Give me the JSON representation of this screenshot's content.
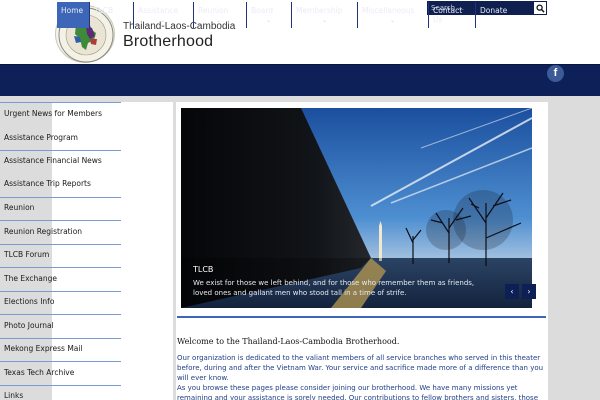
{
  "header": {
    "brand_line1": "Thailand-Laos-Cambodia",
    "brand_line2": "Brotherhood",
    "search_placeholder": "Search ..."
  },
  "nav": {
    "items": [
      {
        "label": "Home",
        "active": true,
        "has_submenu": false
      },
      {
        "label": "TLCB",
        "active": false,
        "has_submenu": true
      },
      {
        "label": "Assistance",
        "active": false,
        "has_submenu": true
      },
      {
        "label": "Reunion",
        "active": false,
        "has_submenu": true
      },
      {
        "label": "Board",
        "active": false,
        "has_submenu": true
      },
      {
        "label": "Membership",
        "active": false,
        "has_submenu": true
      },
      {
        "label": "Miscellaneous",
        "active": false,
        "has_submenu": true
      },
      {
        "label": "Contact Us",
        "active": false,
        "has_submenu": false
      },
      {
        "label": "Donate",
        "active": false,
        "has_submenu": false
      }
    ],
    "submenu_glyph": "⌄",
    "facebook_glyph": "f"
  },
  "sidebar": {
    "items": [
      "Urgent News for Members",
      "Assistance Program",
      "Assistance Financial News",
      "Assistance Trip Reports",
      "Reunion",
      "Reunion Registration",
      "TLCB Forum",
      "The Exchange",
      "Elections Info",
      "Photo Journal",
      "Mekong Express Mail",
      "Texas Tech Archive",
      "Links"
    ]
  },
  "slider": {
    "title": "TLCB",
    "text": "We exist for those we left behind, and for those who remember them as friends, loved ones and gallant men who stood tall in a time of strife.",
    "prev_glyph": "‹",
    "next_glyph": "›"
  },
  "main": {
    "welcome_title": "Welcome to the Thailand-Laos-Cambodia Brotherhood.",
    "para1": "Our organization is dedicated to the valiant members of all service branches who served in this theater before, during and after the Vietnam War. Your service and sacrifice made more of a difference than you will ever know.",
    "para2": "As you browse these pages please consider joining our brotherhood. We have many missions yet remaining and your assistance is sorely needed. Our contributions to fellow brothers and sisters, those we left behind in the"
  },
  "colors": {
    "nav_bg": "#0d2058",
    "nav_active": "#3e66b8",
    "accent_rule": "#3e66b8",
    "link_text": "#1f3f86",
    "facebook": "#3c5a98"
  }
}
